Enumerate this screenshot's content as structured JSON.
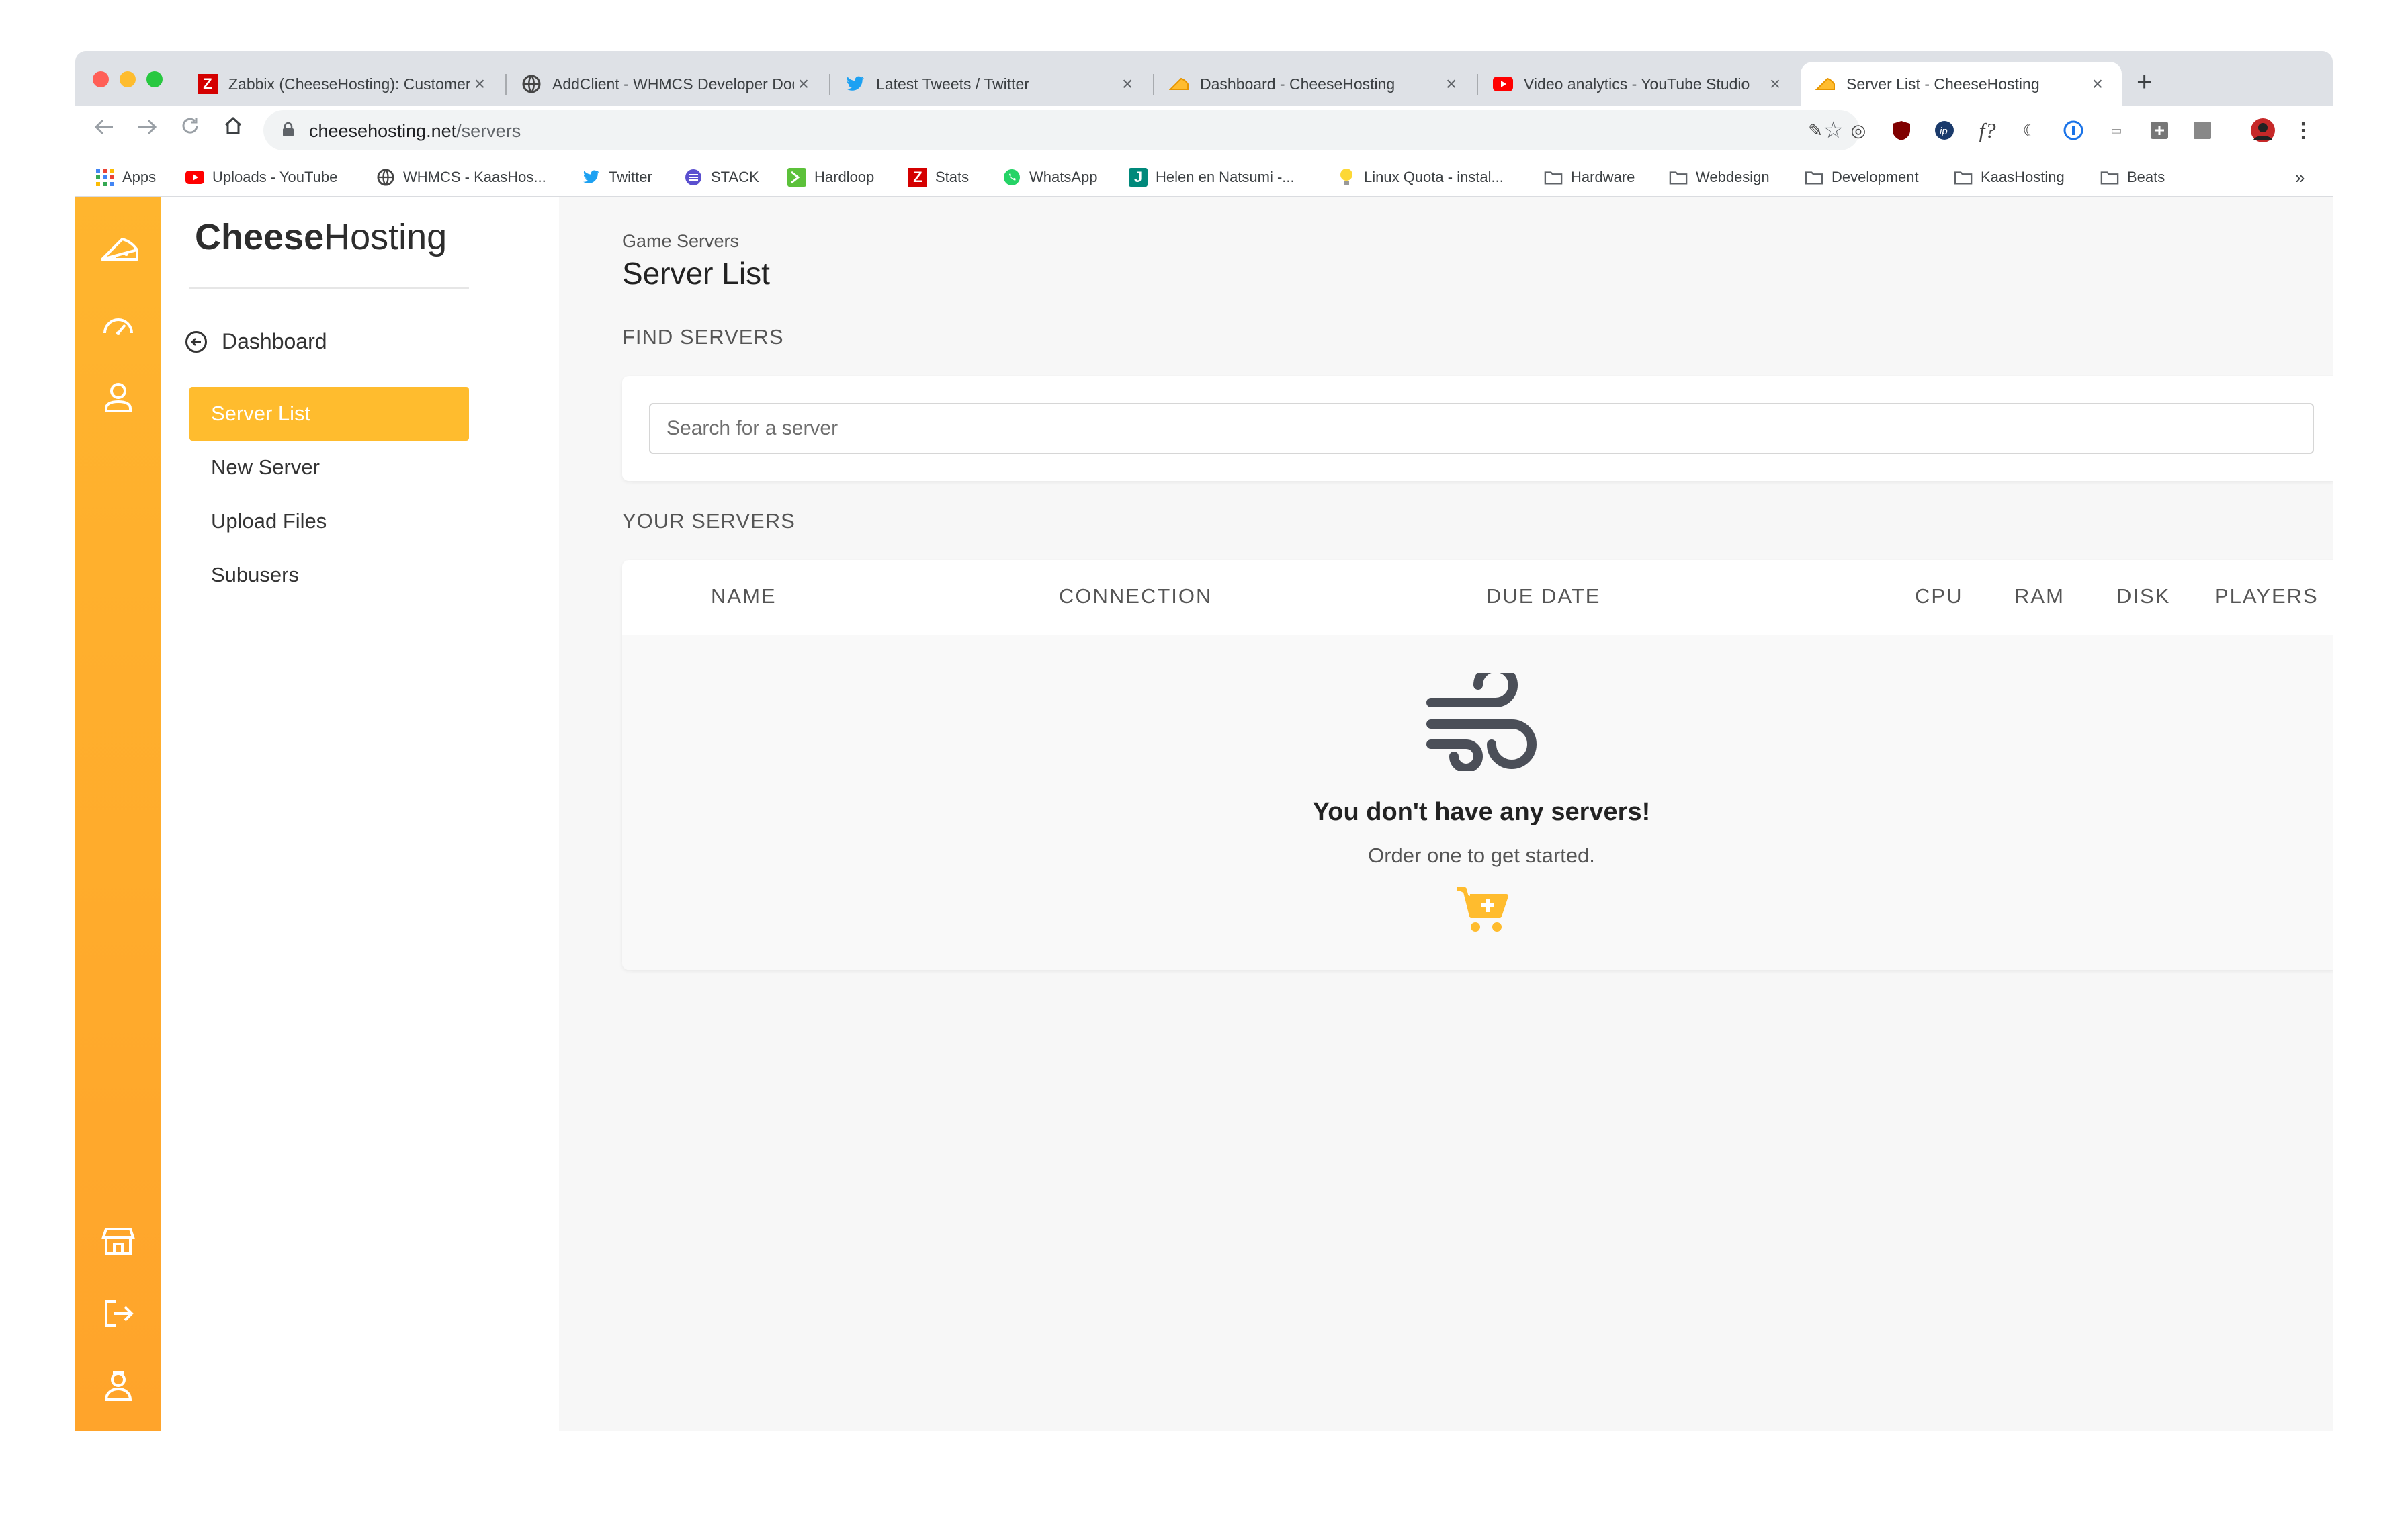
{
  "browser": {
    "tabs": [
      {
        "title": "Zabbix (CheeseHosting): Customer",
        "favicon": "zabbix-icon"
      },
      {
        "title": "AddClient - WHMCS Developer Docs",
        "favicon": "globe-icon"
      },
      {
        "title": "Latest Tweets / Twitter",
        "favicon": "twitter-icon"
      },
      {
        "title": "Dashboard - CheeseHosting",
        "favicon": "cheese-icon"
      },
      {
        "title": "Video analytics - YouTube Studio",
        "favicon": "youtube-icon"
      },
      {
        "title": "Server List - CheeseHosting",
        "favicon": "cheese-icon"
      }
    ],
    "url_host": "cheesehosting.net",
    "url_path": "/servers",
    "bookmarks": [
      {
        "label": "Apps",
        "icon": "apps-grid-icon"
      },
      {
        "label": "Uploads - YouTube",
        "icon": "youtube-icon"
      },
      {
        "label": "WHMCS - KaasHos...",
        "icon": "globe-icon"
      },
      {
        "label": "Twitter",
        "icon": "twitter-icon"
      },
      {
        "label": "STACK",
        "icon": "stack-icon"
      },
      {
        "label": "Hardloop",
        "icon": "hardloop-icon"
      },
      {
        "label": "Stats",
        "icon": "zabbix-icon"
      },
      {
        "label": "WhatsApp",
        "icon": "whatsapp-icon"
      },
      {
        "label": "Helen en Natsumi -...",
        "icon": "j-icon"
      },
      {
        "label": "Linux Quota - instal...",
        "icon": "bulb-icon"
      },
      {
        "label": "Hardware",
        "icon": "folder-icon"
      },
      {
        "label": "Webdesign",
        "icon": "folder-icon"
      },
      {
        "label": "Development",
        "icon": "folder-icon"
      },
      {
        "label": "KaasHosting",
        "icon": "folder-icon"
      },
      {
        "label": "Beats",
        "icon": "folder-icon"
      }
    ],
    "more_bookmarks": "»",
    "colors": {
      "tabstrip": "#dee1e6",
      "twitter": "#1da1f2",
      "youtube": "#ff0000",
      "zabbix": "#d40000"
    }
  },
  "app": {
    "brand_bold": "Cheese",
    "brand_light": "Hosting",
    "accent": "#ffbc2e",
    "back_label": "Dashboard",
    "menu": [
      {
        "label": "Server List",
        "active": true
      },
      {
        "label": "New Server",
        "active": false
      },
      {
        "label": "Upload Files",
        "active": false
      },
      {
        "label": "Subusers",
        "active": false
      }
    ]
  },
  "main": {
    "breadcrumb": "Game Servers",
    "title": "Server List",
    "find_heading": "FIND SERVERS",
    "search_placeholder": "Search for a server",
    "servers_heading": "YOUR SERVERS",
    "columns": [
      "NAME",
      "CONNECTION",
      "DUE DATE",
      "CPU",
      "RAM",
      "DISK",
      "PLAYERS"
    ],
    "empty_title": "You don't have any servers!",
    "empty_subtitle": "Order one to get started."
  }
}
